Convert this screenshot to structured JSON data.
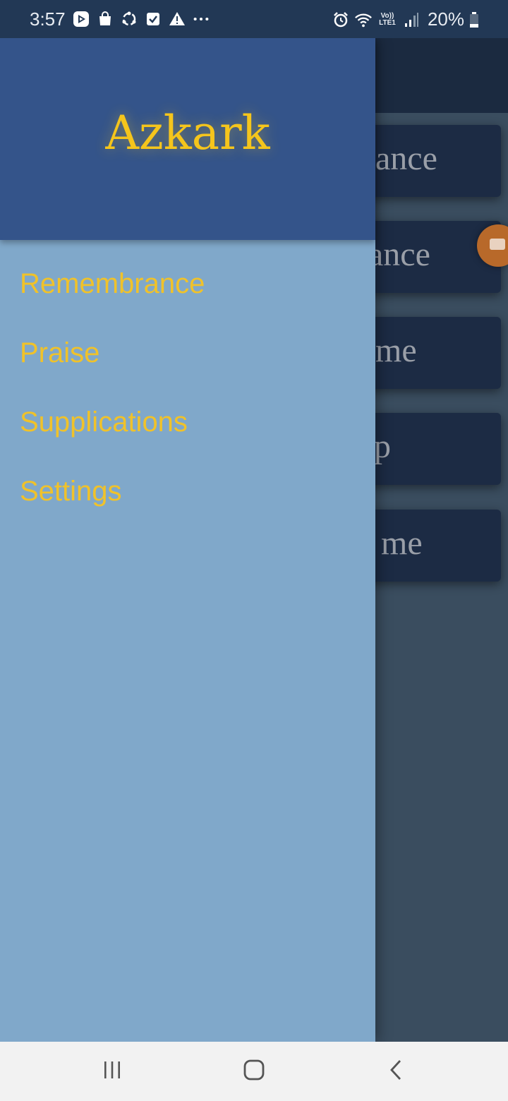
{
  "status_bar": {
    "time": "3:57",
    "left_icons": [
      "play-store-icon",
      "shopping-bag-icon",
      "sync-icon",
      "checkbox-icon",
      "warning-icon",
      "more-dots-icon"
    ],
    "right_icons": [
      "alarm-icon",
      "wifi-icon",
      "lte-icon",
      "signal-icon",
      "battery-icon"
    ],
    "lte_top": "Vo))",
    "lte_bottom": "LTE1",
    "battery": "20%"
  },
  "drawer": {
    "title": "Azkark",
    "items": [
      {
        "label": "Remembrance"
      },
      {
        "label": "Praise"
      },
      {
        "label": "Supplications"
      },
      {
        "label": "Settings"
      }
    ]
  },
  "background_cards": [
    {
      "text": "ance"
    },
    {
      "text": "ance"
    },
    {
      "text": "me"
    },
    {
      "text": "p"
    },
    {
      "text": "me"
    }
  ],
  "nav_bar": {
    "buttons": [
      "recent-apps-icon",
      "home-icon",
      "back-icon"
    ]
  },
  "colors": {
    "drawer_header": "#34548a",
    "drawer_body": "#80a8ca",
    "accent_text": "#f5c51c",
    "status_bar": "#223855"
  }
}
